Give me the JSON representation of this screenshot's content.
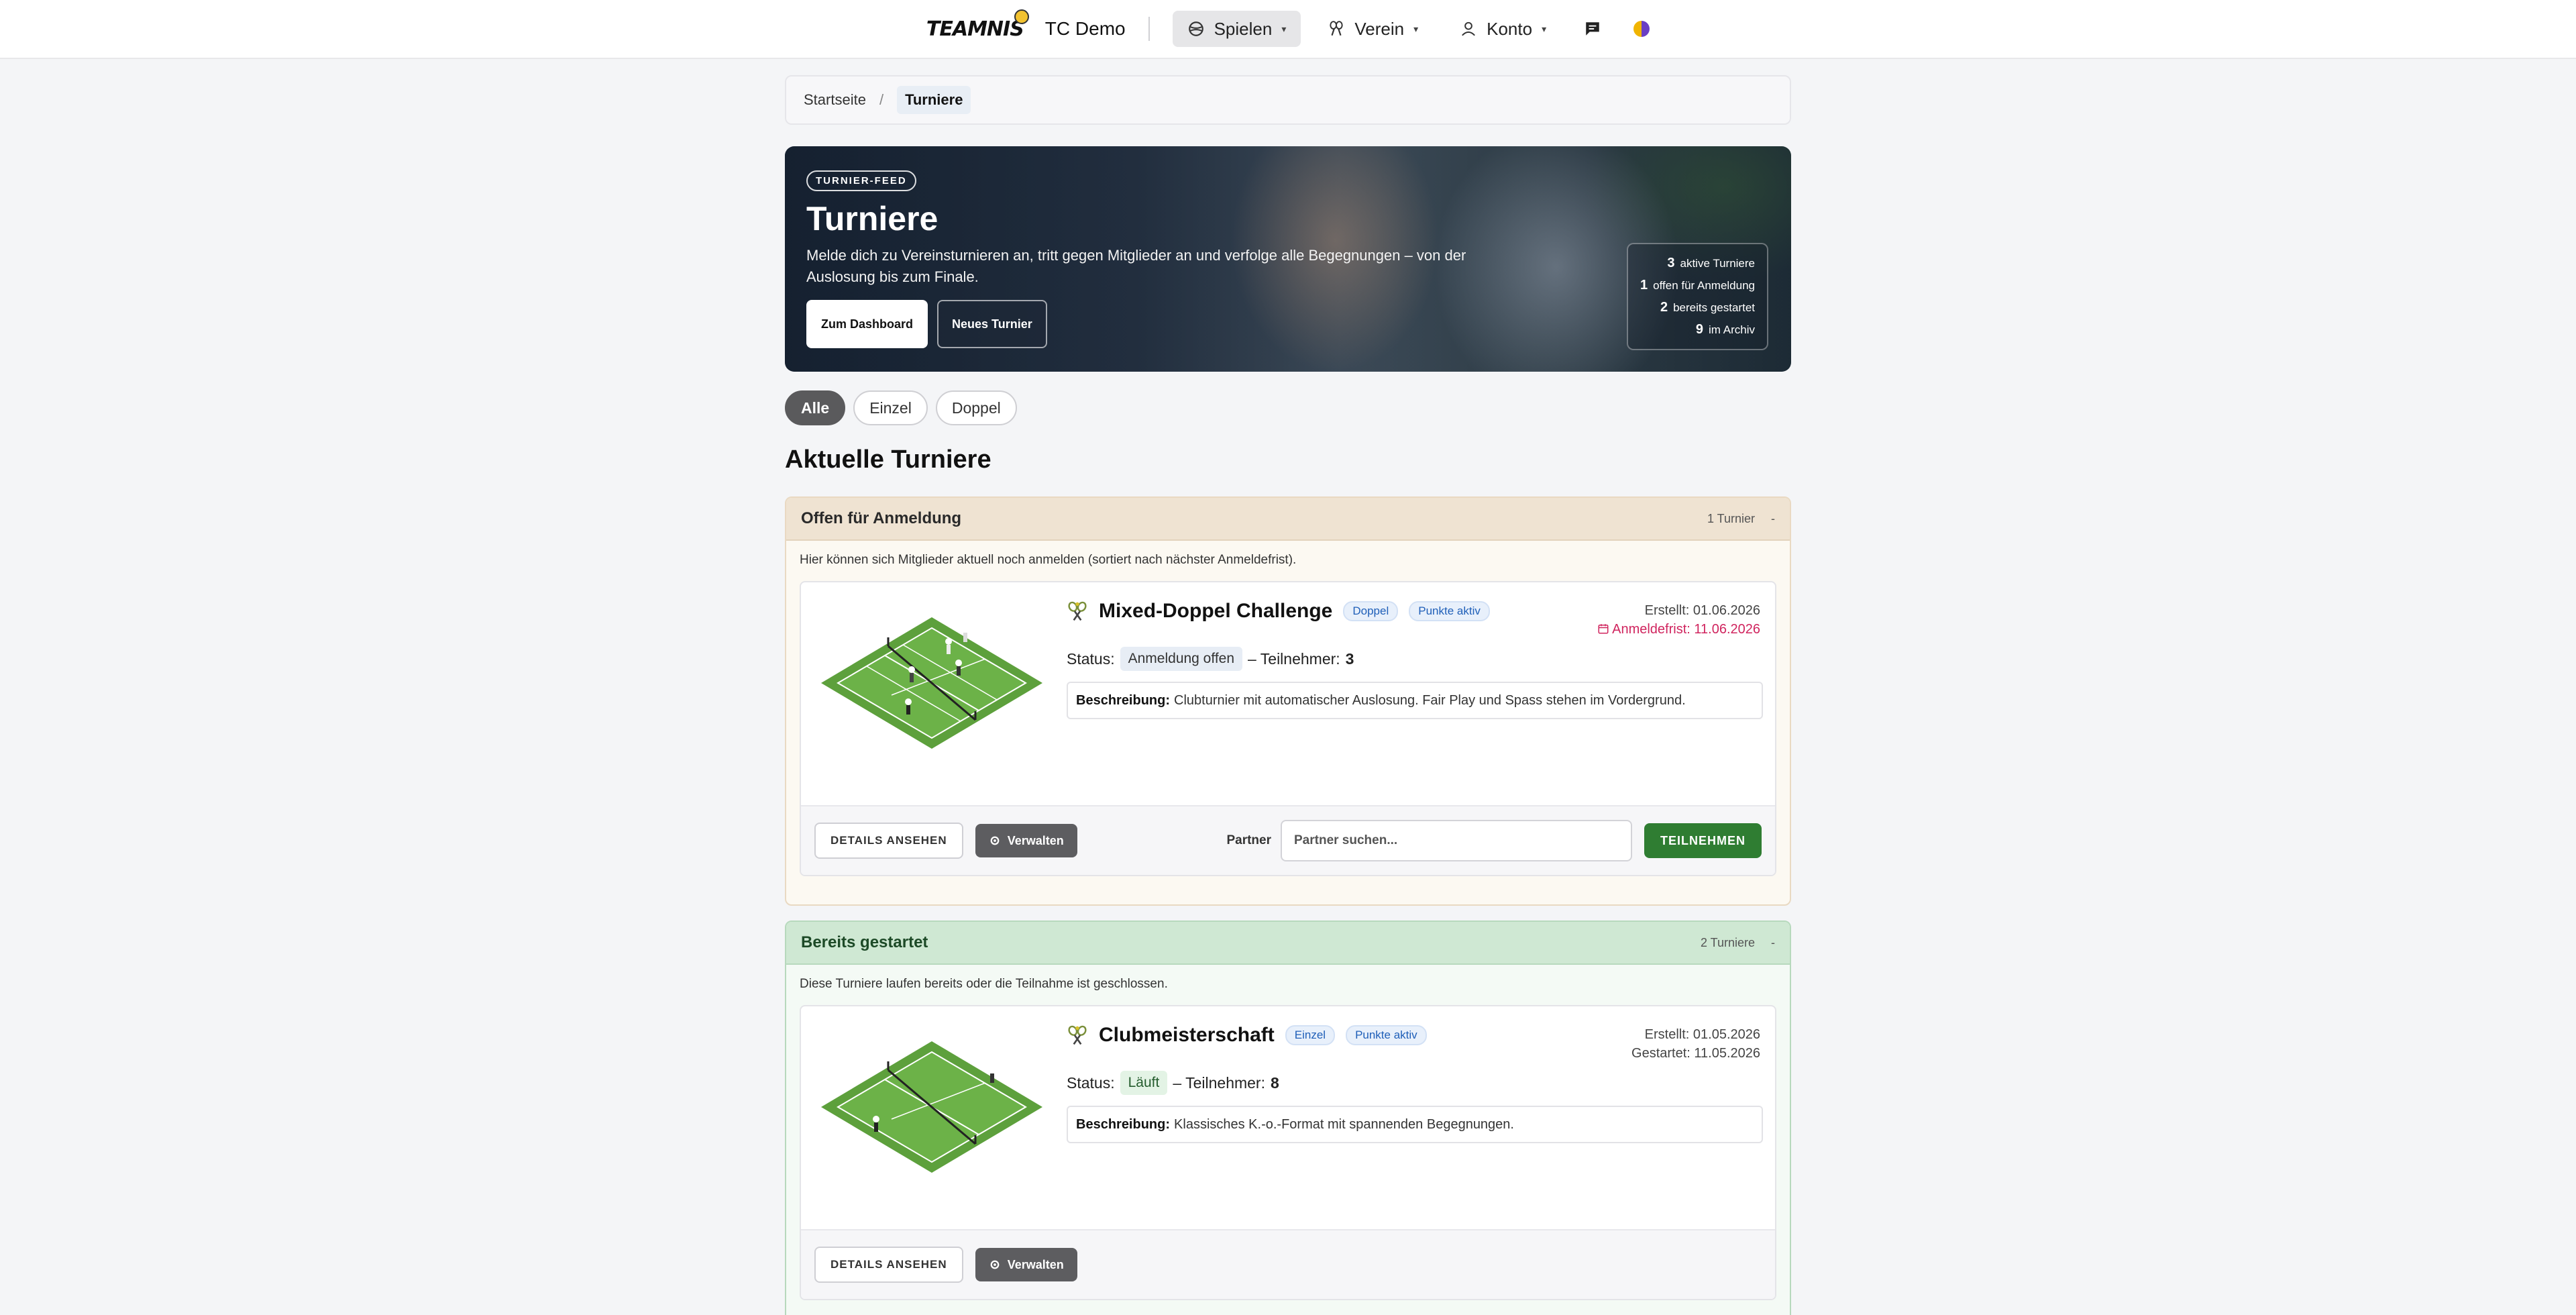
{
  "nav": {
    "logo": "TEAMNIS",
    "club": "TC Demo",
    "items": [
      {
        "label": "Spielen",
        "icon": "tennis-ball-icon"
      },
      {
        "label": "Verein",
        "icon": "rackets-icon"
      },
      {
        "label": "Konto",
        "icon": "user-icon"
      }
    ],
    "messages_icon": "chat-icon",
    "theme_icon": "theme-toggle-icon"
  },
  "breadcrumb": {
    "home": "Startseite",
    "separator": "/",
    "current": "Turniere"
  },
  "hero": {
    "badge": "TURNIER-FEED",
    "title": "Turniere",
    "subtitle": "Melde dich zu Vereinsturnieren an, tritt gegen Mitglieder an und verfolge alle Begegnungen – von der Auslosung bis zum Finale.",
    "btn_dashboard": "Zum Dashboard",
    "btn_new": "Neues Turnier",
    "stats": [
      {
        "value": "3",
        "label": "aktive Turniere"
      },
      {
        "value": "1",
        "label": "offen für Anmeldung"
      },
      {
        "value": "2",
        "label": "bereits gestartet"
      },
      {
        "value": "9",
        "label": "im Archiv"
      }
    ]
  },
  "filters": [
    "Alle",
    "Einzel",
    "Doppel"
  ],
  "section_title": "Aktuelle Turniere",
  "groups": {
    "open": {
      "title": "Offen für Anmeldung",
      "count": "1 Turnier",
      "toggle": "-",
      "description": "Hier können sich Mitglieder aktuell noch anmelden (sortiert nach nächster Anmeldefrist).",
      "card": {
        "title": "Mixed-Doppel Challenge",
        "tags": [
          "Doppel",
          "Punkte aktiv"
        ],
        "created": "Erstellt: 01.06.2026",
        "deadline": "Anmeldefrist: 11.06.2026",
        "status_label": "Status:",
        "status": "Anmeldung offen",
        "participants_label": "– Teilnehmer:",
        "participants": "3",
        "desc_label": "Beschreibung:",
        "desc": "Clubturnier mit automatischer Auslosung. Fair Play und Spass stehen im Vordergrund.",
        "btn_details": "DETAILS ANSEHEN",
        "btn_manage": "Verwalten",
        "partner_label": "Partner",
        "partner_placeholder": "Partner suchen...",
        "btn_join": "TEILNEHMEN"
      }
    },
    "started": {
      "title": "Bereits gestartet",
      "count": "2 Turniere",
      "toggle": "-",
      "description": "Diese Turniere laufen bereits oder die Teilnahme ist geschlossen.",
      "card": {
        "title": "Clubmeisterschaft",
        "tags": [
          "Einzel",
          "Punkte aktiv"
        ],
        "created": "Erstellt: 01.05.2026",
        "started": "Gestartet: 11.05.2026",
        "status_label": "Status:",
        "status": "Läuft",
        "participants_label": "– Teilnehmer:",
        "participants": "8",
        "desc_label": "Beschreibung:",
        "desc": "Klassisches K.-o.-Format mit spannenden Begegnungen.",
        "btn_details": "DETAILS ANSEHEN",
        "btn_manage": "Verwalten"
      }
    }
  }
}
